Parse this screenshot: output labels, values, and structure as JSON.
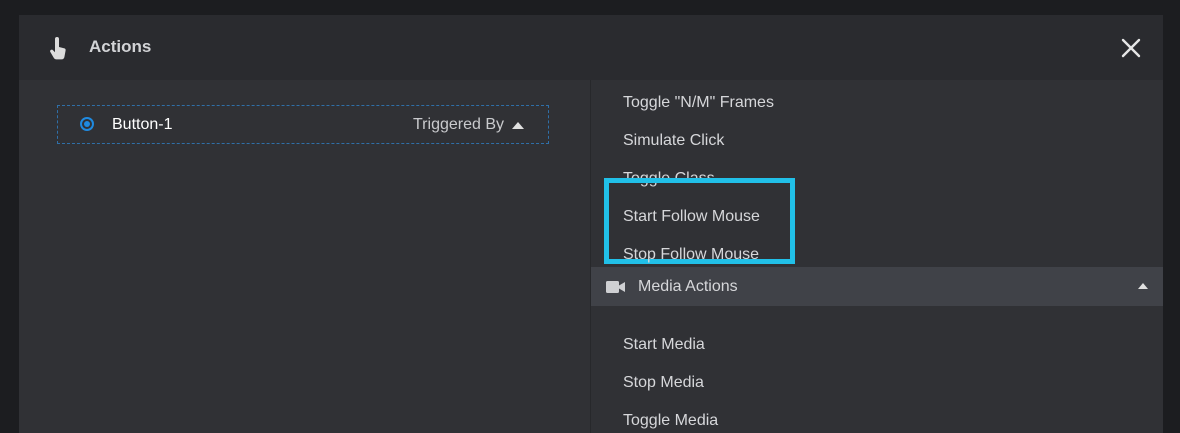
{
  "dialog": {
    "title": "Actions",
    "icon": "hand-pointer-icon",
    "close_icon": "close-icon"
  },
  "trigger": {
    "name": "Button-1",
    "triggered_by_label": "Triggered By",
    "selected": true
  },
  "actions": {
    "items": [
      "Toggle \"N/M\" Frames",
      "Simulate Click",
      "Toggle Class",
      "Start Follow Mouse",
      "Stop Follow Mouse"
    ],
    "media_group": {
      "label": "Media Actions",
      "icon": "video-camera-icon",
      "items": [
        "Start Media",
        "Stop Media",
        "Toggle Media"
      ]
    }
  },
  "colors": {
    "accent": "#1f8ae0",
    "highlight": "#21c0e8"
  }
}
